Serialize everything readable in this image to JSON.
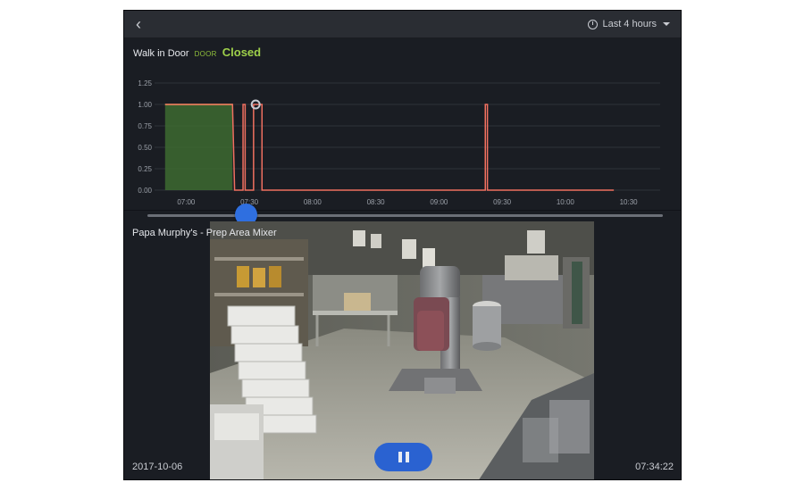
{
  "header": {
    "back_icon": "chevron-left-icon",
    "range_icon": "clock-icon",
    "range_label": "Last 4 hours",
    "range_caret_icon": "caret-down-icon"
  },
  "sensor": {
    "name": "Walk in Door",
    "type": "DOOR",
    "state": "Closed",
    "state_color": "#9ed04a"
  },
  "chart_data": {
    "type": "line",
    "title": "",
    "xlabel": "",
    "ylabel": "",
    "ylim": [
      0,
      1.25
    ],
    "yticks": [
      "0.00",
      "0.25",
      "0.50",
      "0.75",
      "1.00",
      "1.25"
    ],
    "xticks": [
      "07:00",
      "07:30",
      "08:00",
      "08:30",
      "09:00",
      "09:30",
      "10:00",
      "10:30"
    ],
    "grid": true,
    "series": [
      {
        "color": "#f07060",
        "points": [
          [
            "06:50",
            1
          ],
          [
            "07:22",
            1
          ],
          [
            "07:23",
            0
          ],
          [
            "07:27",
            0
          ],
          [
            "07:27",
            1
          ],
          [
            "07:28",
            1
          ],
          [
            "07:28",
            0
          ],
          [
            "07:32",
            0
          ],
          [
            "07:32",
            1
          ],
          [
            "07:36",
            1
          ],
          [
            "07:36",
            0
          ],
          [
            "09:22",
            0
          ],
          [
            "09:22",
            1
          ],
          [
            "09:23",
            1
          ],
          [
            "09:23",
            0
          ],
          [
            "10:23",
            0
          ]
        ]
      }
    ],
    "open_fill": {
      "from": "06:50",
      "to": "07:22",
      "color": "#3d6a30",
      "line_color": "#8fc43c"
    },
    "marker": {
      "time": "07:33",
      "value": 1
    }
  },
  "scrubber": {
    "position_fraction": 0.19
  },
  "camera": {
    "name": "Papa Murphy's - Prep Area Mixer",
    "date": "2017-10-06",
    "time": "07:34:22",
    "pause_icon": "pause-icon"
  }
}
